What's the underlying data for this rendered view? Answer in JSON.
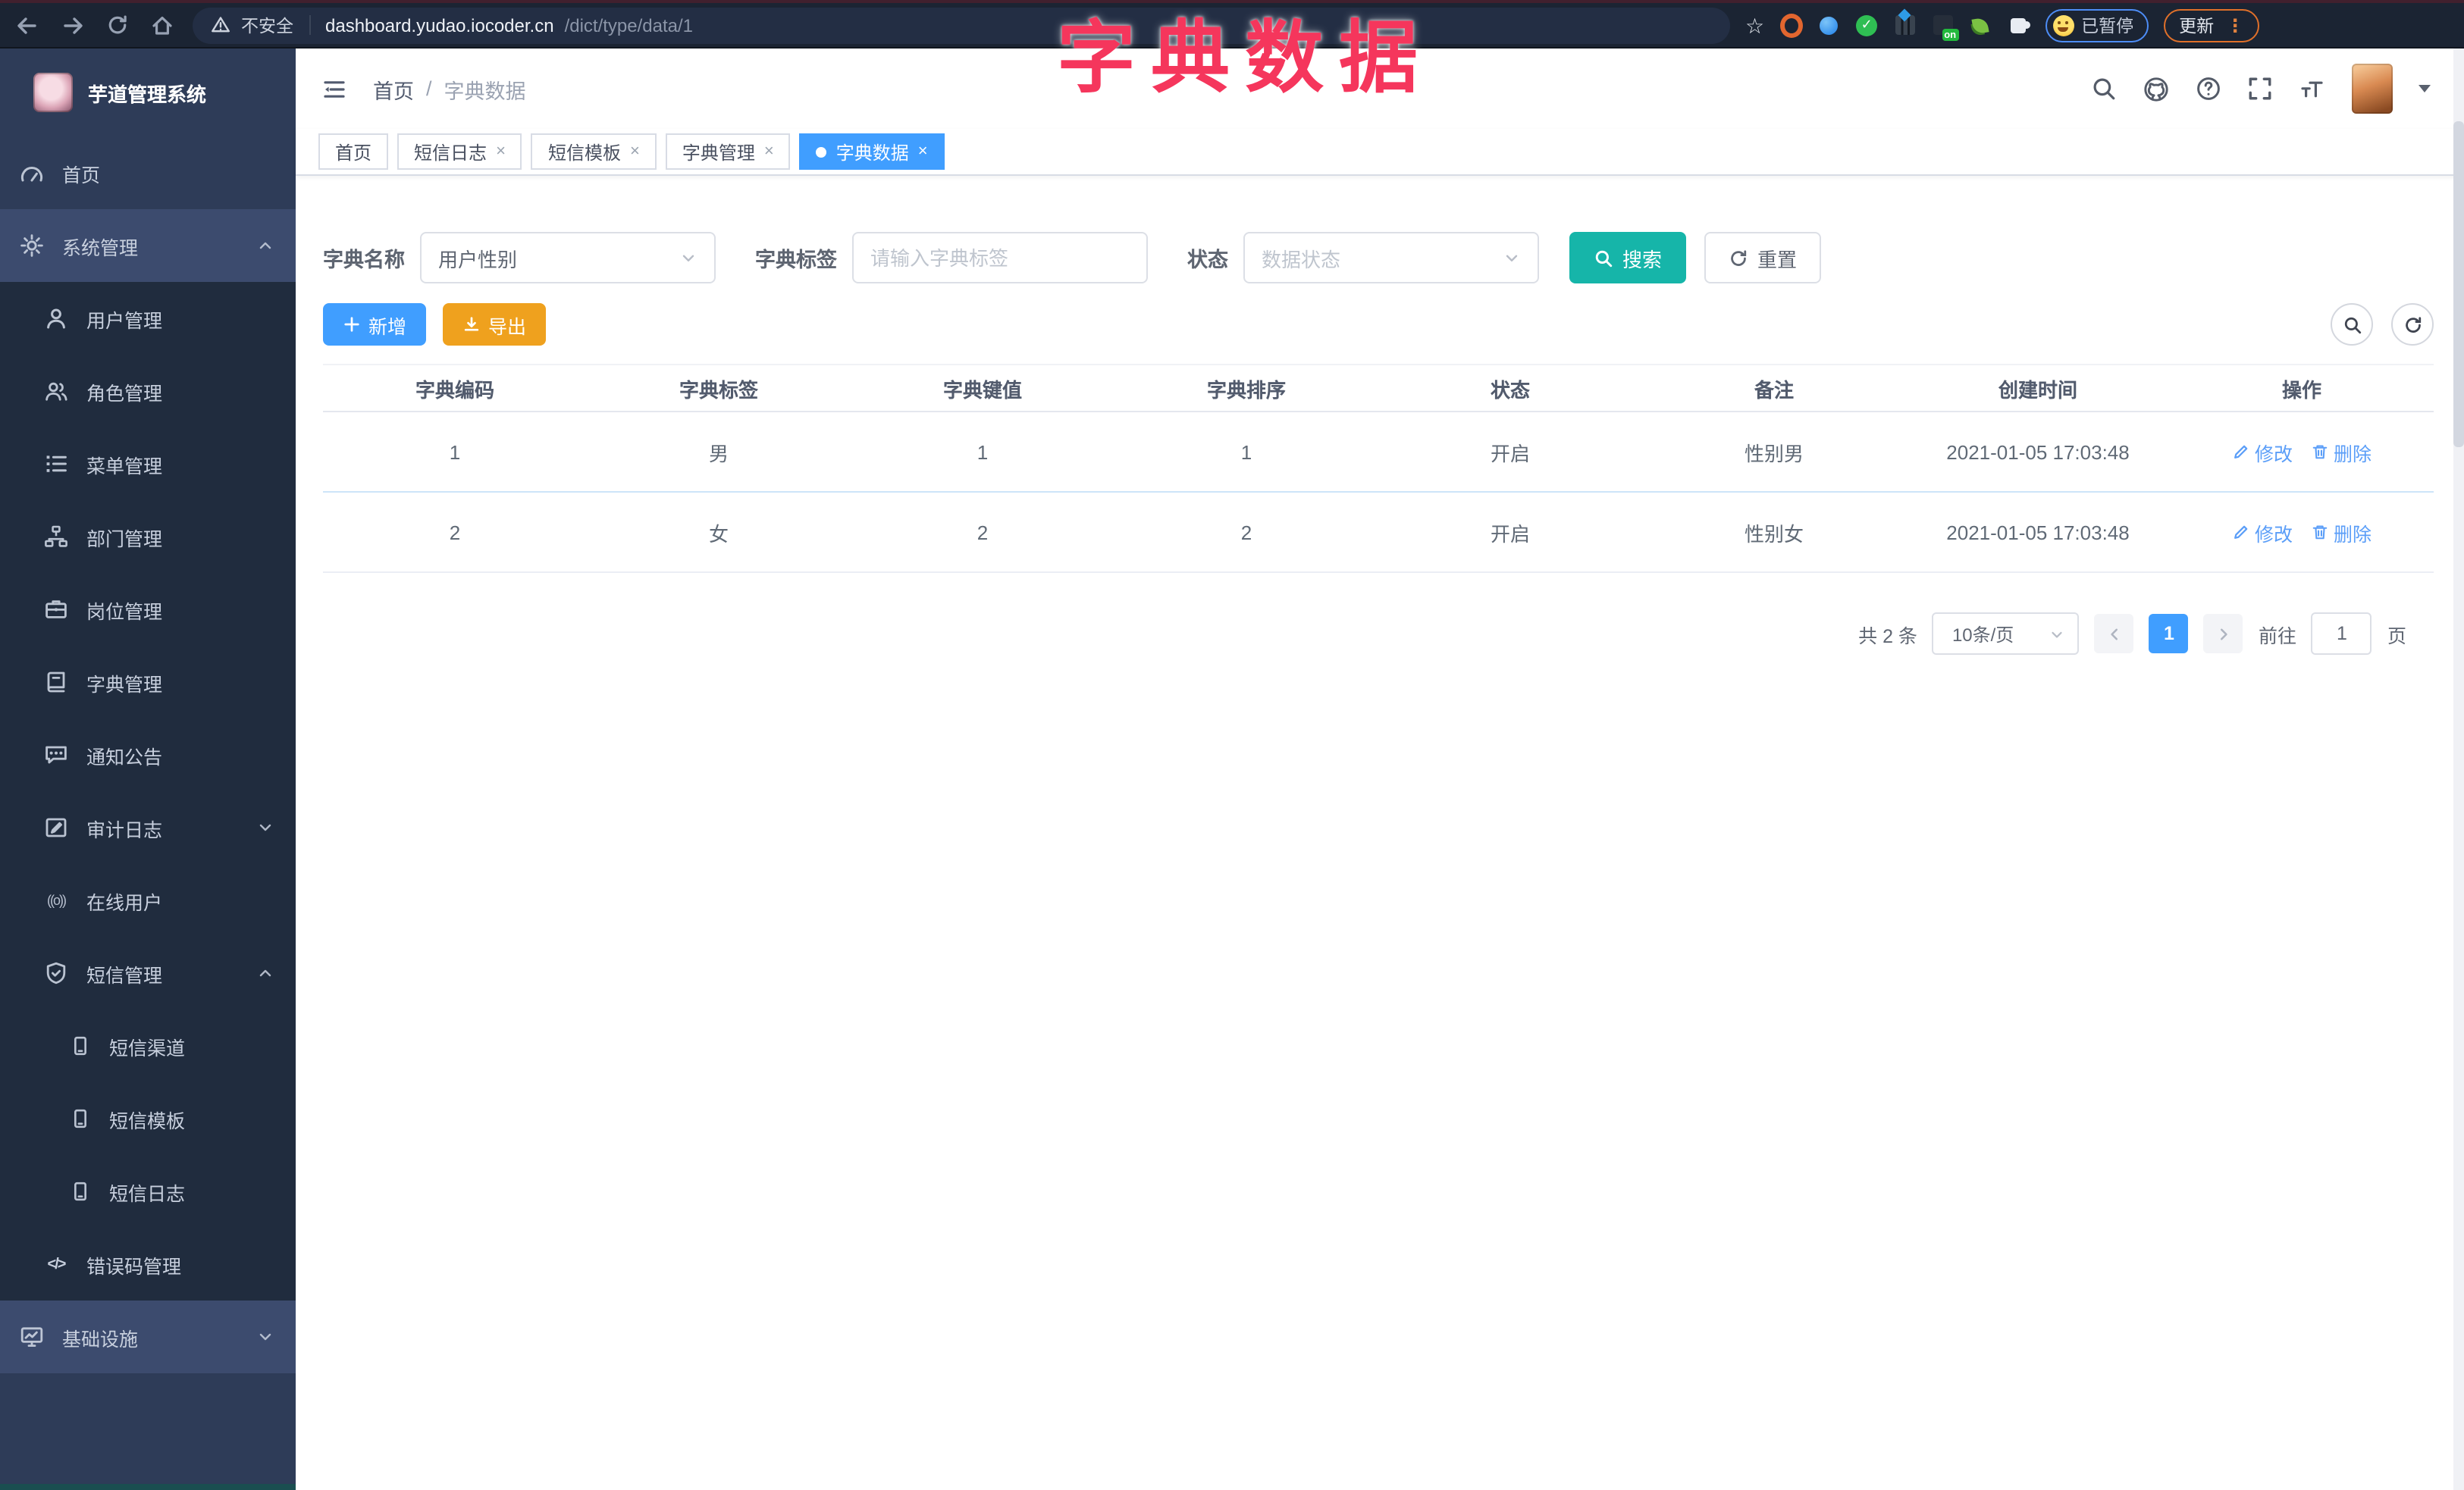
{
  "browser": {
    "security": "不安全",
    "url_domain": "dashboard.yudao.iocoder.cn",
    "url_path": "/dict/type/data/1",
    "ext_on_badge": "on",
    "paused": "已暂停",
    "update": "更新"
  },
  "overlay": {
    "title": "字典数据"
  },
  "sidebar": {
    "app_title": "芋道管理系统",
    "items": [
      {
        "label": "首页"
      },
      {
        "label": "系统管理"
      },
      {
        "label": "用户管理"
      },
      {
        "label": "角色管理"
      },
      {
        "label": "菜单管理"
      },
      {
        "label": "部门管理"
      },
      {
        "label": "岗位管理"
      },
      {
        "label": "字典管理"
      },
      {
        "label": "通知公告"
      },
      {
        "label": "审计日志"
      },
      {
        "label": "在线用户"
      },
      {
        "label": "短信管理"
      },
      {
        "label": "短信渠道"
      },
      {
        "label": "短信模板"
      },
      {
        "label": "短信日志"
      },
      {
        "label": "错误码管理"
      },
      {
        "label": "基础设施"
      }
    ]
  },
  "header": {
    "breadcrumb_home": "首页",
    "breadcrumb_sep": "/",
    "breadcrumb_current": "字典数据"
  },
  "tabs": {
    "items": [
      {
        "label": "首页"
      },
      {
        "label": "短信日志"
      },
      {
        "label": "短信模板"
      },
      {
        "label": "字典管理"
      },
      {
        "label": "字典数据"
      }
    ]
  },
  "filters": {
    "name_label": "字典名称",
    "name_value": "用户性别",
    "tag_label": "字典标签",
    "tag_placeholder": "请输入字典标签",
    "status_label": "状态",
    "status_placeholder": "数据状态",
    "search": "搜索",
    "reset": "重置"
  },
  "toolbar": {
    "add": "新增",
    "export": "导出"
  },
  "table": {
    "columns": [
      "字典编码",
      "字典标签",
      "字典键值",
      "字典排序",
      "状态",
      "备注",
      "创建时间",
      "操作"
    ],
    "rows": [
      {
        "code": "1",
        "label": "男",
        "value": "1",
        "sort": "1",
        "status": "开启",
        "remark": "性别男",
        "created": "2021-01-05 17:03:48"
      },
      {
        "code": "2",
        "label": "女",
        "value": "2",
        "sort": "2",
        "status": "开启",
        "remark": "性别女",
        "created": "2021-01-05 17:03:48"
      }
    ],
    "edit": "修改",
    "delete": "删除"
  },
  "pagination": {
    "total": "共 2 条",
    "size": "10条/页",
    "page": "1",
    "goto": "前往",
    "goto_value": "1",
    "unit": "页"
  },
  "colors": {
    "primary": "#409eff",
    "search_button": "#16b5a9",
    "export_button": "#efa11e",
    "overlay_title": "#f5365c",
    "sidebar_bg": "#2e3c58",
    "chrome_bg": "#1b2433"
  }
}
